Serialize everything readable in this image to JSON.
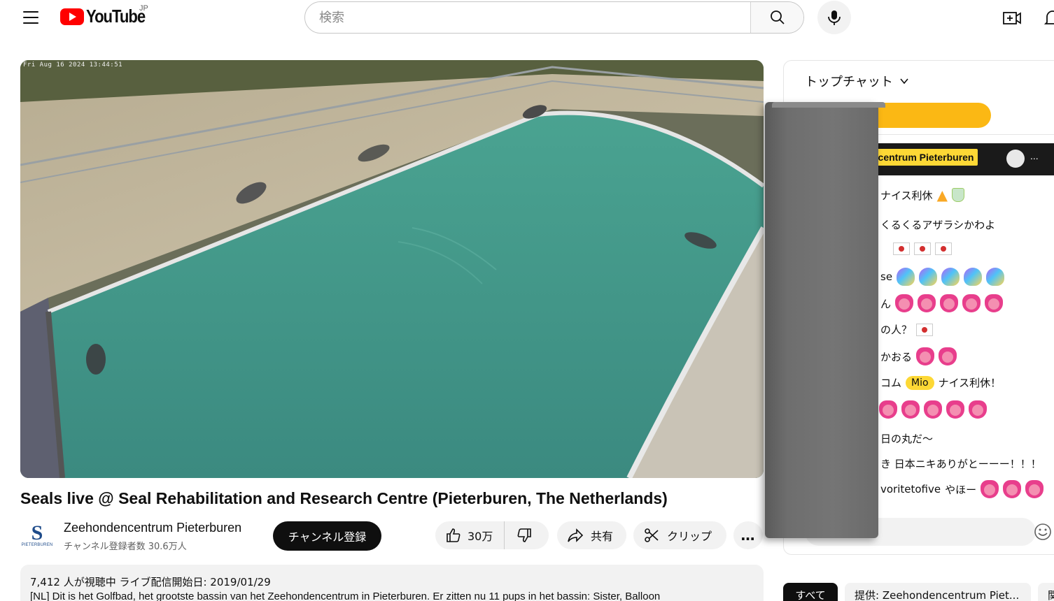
{
  "header": {
    "logo_text": "YouTube",
    "region": "JP",
    "search_placeholder": "検索"
  },
  "video": {
    "timestamp_overlay": "Fri Aug 16 2024 13:44:51",
    "title": "Seals live @ Seal Rehabilitation and Research Centre (Pieterburen, The Netherlands)"
  },
  "channel": {
    "name": "Zeehondencentrum Pieterburen",
    "subscribers": "チャンネル登録者数 30.6万人",
    "avatar_letter": "S",
    "avatar_sub": "PIETERBUREN",
    "subscribe_label": "チャンネル登録"
  },
  "actions": {
    "like_count": "30万",
    "share_label": "共有",
    "clip_label": "クリップ",
    "more_label": "…"
  },
  "description": {
    "meta": "7,412 人が視聴中  ライブ配信開始日: 2019/01/29",
    "text": "[NL] Dit is het Golfbad, het grootste bassin van het Zeehondencentrum in Pieterburen. Er zitten nu 11 pups in het bassin: Sister, Balloon"
  },
  "chat": {
    "header_label": "トップチャット",
    "pinned_badge": "ncentrum Pieterburen",
    "pinned_more": "...",
    "messages": [
      {
        "text": "ナイス利休"
      },
      {
        "text": "くるくるアザラシかわよ"
      },
      {
        "text": ""
      },
      {
        "text": "se"
      },
      {
        "text": "ん"
      },
      {
        "text": "の人？"
      },
      {
        "text": "かおる"
      },
      {
        "author": "コム",
        "badge": "Mio",
        "text": "ナイス利休！"
      },
      {
        "text": ""
      },
      {
        "text": "日の丸だ〜"
      },
      {
        "text": "き  日本ニキありがとーーー！！！"
      },
      {
        "author": "voritetofive",
        "text": "やほー"
      }
    ]
  },
  "chips": {
    "all": "すべて",
    "provider": "提供: Zeehondencentrum Piet...",
    "related": "関"
  },
  "colors": {
    "brand_red": "#ff0000",
    "pool_water": "#3e8f84",
    "badge_yellow": "#fdd835",
    "pill_orange": "#fbb814"
  }
}
